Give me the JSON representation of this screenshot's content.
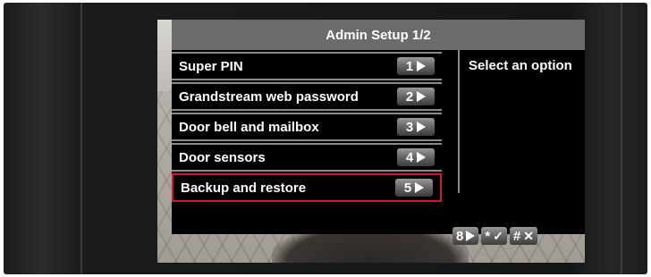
{
  "screen": {
    "title": "Admin Setup 1/2",
    "hint": "Select an option",
    "menu": [
      {
        "label": "Super PIN",
        "key": "1",
        "selected": false
      },
      {
        "label": "Grandstream web password",
        "key": "2",
        "selected": false
      },
      {
        "label": "Door bell and mailbox",
        "key": "3",
        "selected": false
      },
      {
        "label": "Door sensors",
        "key": "4",
        "selected": false
      },
      {
        "label": "Backup and restore",
        "key": "5",
        "selected": true
      }
    ],
    "footer": [
      {
        "key": "8",
        "icon": "play-icon"
      },
      {
        "key": "*",
        "icon": "checkmark-icon",
        "glyph": "✓"
      },
      {
        "key": "#",
        "icon": "close-icon",
        "glyph": "✕"
      }
    ]
  },
  "colors": {
    "title_bar": "#6b6b6b",
    "panel": "#000000",
    "divider": "#8a8a8a",
    "selection": "#d01830",
    "text": "#ffffff"
  }
}
